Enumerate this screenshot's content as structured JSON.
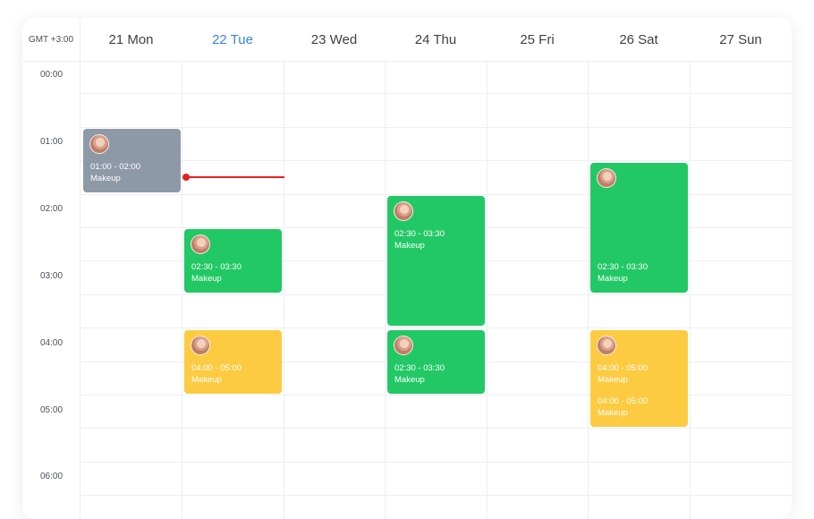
{
  "timezone": "GMT +3:00",
  "days": [
    "21 Mon",
    "22 Tue",
    "23 Wed",
    "24 Thu",
    "25 Fri",
    "26 Sat",
    "27 Sun"
  ],
  "today_label": "22 Tue",
  "times": [
    "00:00",
    "01:00",
    "02:00",
    "03:00",
    "04:00",
    "05:00",
    "06:00"
  ],
  "events": {
    "mon_1": {
      "time": "01:00 - 02:00",
      "title": "Makeup"
    },
    "tue_1": {
      "time": "02:30 - 03:30",
      "title": "Makeup"
    },
    "tue_2": {
      "time": "04:00 - 05:00",
      "title": "Makeup"
    },
    "thu_1": {
      "time": "02:30 - 03:30",
      "title": "Makeup"
    },
    "thu_2": {
      "time": "02:30 - 03:30",
      "title": "Makeup"
    },
    "sat_1": {
      "time": "02:30 - 03:30",
      "title": "Makeup"
    },
    "sat_2a": {
      "time": "04:00 - 05:00",
      "title": "Makeup"
    },
    "sat_2b": {
      "time": "04:00 - 05:00",
      "title": "Makeup"
    }
  },
  "colors": {
    "gray": "#8e99a8",
    "green": "#22c865",
    "yellow": "#fccb42",
    "today": "#3a86e0",
    "now_line": "#e52020"
  }
}
